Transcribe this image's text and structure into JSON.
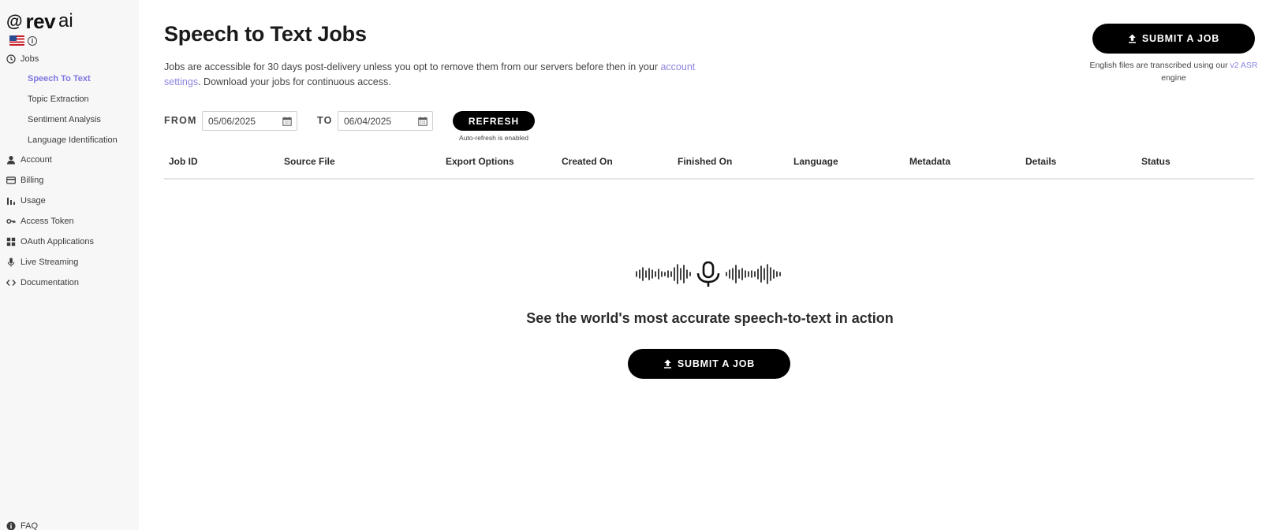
{
  "brand": {
    "at": "@",
    "name": "rev",
    "suffix": "ai"
  },
  "sidebar": {
    "jobs_label": "Jobs",
    "sub_items": [
      {
        "label": "Speech To Text",
        "active": true
      },
      {
        "label": "Topic Extraction",
        "active": false
      },
      {
        "label": "Sentiment Analysis",
        "active": false
      },
      {
        "label": "Language Identification",
        "active": false
      }
    ],
    "items": [
      {
        "label": "Account",
        "icon": "person-icon"
      },
      {
        "label": "Billing",
        "icon": "card-icon"
      },
      {
        "label": "Usage",
        "icon": "bar-chart-icon"
      },
      {
        "label": "Access Token",
        "icon": "key-icon"
      },
      {
        "label": "OAuth Applications",
        "icon": "grid-icon"
      },
      {
        "label": "Live Streaming",
        "icon": "mic-icon"
      },
      {
        "label": "Documentation",
        "icon": "code-icon"
      }
    ],
    "faq_label": "FAQ"
  },
  "header": {
    "title": "Speech to Text Jobs",
    "desc_before": "Jobs are accessible for 30 days post-delivery unless you opt to remove them from our servers before then in your ",
    "desc_link": "account settings",
    "desc_after": ". Download your jobs for continuous access.",
    "submit_label": "SUBMIT A JOB",
    "engine_before": "English files are transcribed using our ",
    "engine_link": "v2 ASR",
    "engine_after": " engine"
  },
  "filters": {
    "from_label": "FROM",
    "from_value": "05/06/2025",
    "to_label": "TO",
    "to_value": "06/04/2025",
    "refresh_label": "REFRESH",
    "auto_refresh_note": "Auto-refresh is enabled"
  },
  "table": {
    "columns": [
      "Job ID",
      "Source File",
      "Export Options",
      "Created On",
      "Finished On",
      "Language",
      "Metadata",
      "Details",
      "Status"
    ]
  },
  "empty_state": {
    "message": "See the world's most accurate speech-to-text in action",
    "submit_label": "SUBMIT A JOB"
  },
  "colors": {
    "accent": "#7f77e0",
    "link": "#8b85e0",
    "button": "#000000",
    "sidebar_bg": "#f7f7f7"
  }
}
